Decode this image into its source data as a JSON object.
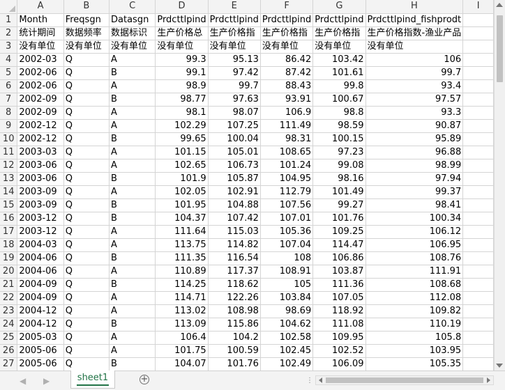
{
  "columns": [
    "A",
    "B",
    "C",
    "D",
    "E",
    "F",
    "G",
    "H",
    "I"
  ],
  "header_rows": [
    [
      "Month",
      "Freqsgn",
      "Datasgn",
      "Prdcttlpind",
      "Prdcttlpind",
      "Prdcttlpind",
      "Prdcttlpind",
      "Prdcttlpind_fishprodt",
      ""
    ],
    [
      "统计期间",
      "数据频率",
      "数据标识",
      "生产价格总",
      "生产价格指",
      "生产价格指",
      "生产价格指",
      "生产价格指数-渔业产品",
      ""
    ],
    [
      "没有单位",
      "没有单位",
      "没有单位",
      "没有单位",
      "没有单位",
      "没有单位",
      "没有单位",
      "没有单位",
      ""
    ]
  ],
  "data_rows": [
    [
      "2002-03",
      "Q",
      "A",
      "99.3",
      "95.13",
      "86.42",
      "103.42",
      "106"
    ],
    [
      "2002-06",
      "Q",
      "B",
      "99.1",
      "97.42",
      "87.42",
      "101.61",
      "99.7"
    ],
    [
      "2002-06",
      "Q",
      "A",
      "98.9",
      "99.7",
      "88.43",
      "99.8",
      "93.4"
    ],
    [
      "2002-09",
      "Q",
      "B",
      "98.77",
      "97.63",
      "93.91",
      "100.67",
      "97.57"
    ],
    [
      "2002-09",
      "Q",
      "A",
      "98.1",
      "98.07",
      "106.9",
      "98.8",
      "93.3"
    ],
    [
      "2002-12",
      "Q",
      "A",
      "102.29",
      "107.25",
      "111.49",
      "98.59",
      "90.87"
    ],
    [
      "2002-12",
      "Q",
      "B",
      "99.65",
      "100.04",
      "98.31",
      "100.15",
      "95.89"
    ],
    [
      "2003-03",
      "Q",
      "A",
      "101.15",
      "105.01",
      "108.65",
      "97.23",
      "96.88"
    ],
    [
      "2003-06",
      "Q",
      "A",
      "102.65",
      "106.73",
      "101.24",
      "99.08",
      "98.99"
    ],
    [
      "2003-06",
      "Q",
      "B",
      "101.9",
      "105.87",
      "104.95",
      "98.16",
      "97.94"
    ],
    [
      "2003-09",
      "Q",
      "A",
      "102.05",
      "102.91",
      "112.79",
      "101.49",
      "99.37"
    ],
    [
      "2003-09",
      "Q",
      "B",
      "101.95",
      "104.88",
      "107.56",
      "99.27",
      "98.41"
    ],
    [
      "2003-12",
      "Q",
      "B",
      "104.37",
      "107.42",
      "107.01",
      "101.76",
      "100.34"
    ],
    [
      "2003-12",
      "Q",
      "A",
      "111.64",
      "115.03",
      "105.36",
      "109.25",
      "106.12"
    ],
    [
      "2004-03",
      "Q",
      "A",
      "113.75",
      "114.82",
      "107.04",
      "114.47",
      "106.95"
    ],
    [
      "2004-06",
      "Q",
      "B",
      "111.35",
      "116.54",
      "108",
      "106.86",
      "108.76"
    ],
    [
      "2004-06",
      "Q",
      "A",
      "110.89",
      "117.37",
      "108.91",
      "103.87",
      "111.91"
    ],
    [
      "2004-09",
      "Q",
      "B",
      "114.25",
      "118.62",
      "105",
      "111.36",
      "108.68"
    ],
    [
      "2004-09",
      "Q",
      "A",
      "114.71",
      "122.26",
      "103.84",
      "107.05",
      "112.08"
    ],
    [
      "2004-12",
      "Q",
      "A",
      "113.02",
      "108.98",
      "98.69",
      "118.92",
      "109.82"
    ],
    [
      "2004-12",
      "Q",
      "B",
      "113.09",
      "115.86",
      "104.62",
      "111.08",
      "110.19"
    ],
    [
      "2005-03",
      "Q",
      "A",
      "106.4",
      "104.2",
      "102.58",
      "109.95",
      "105.8"
    ],
    [
      "2005-06",
      "Q",
      "A",
      "101.75",
      "100.59",
      "102.45",
      "102.52",
      "103.95"
    ],
    [
      "2005-06",
      "Q",
      "B",
      "104.07",
      "101.76",
      "102.49",
      "106.09",
      "105.35"
    ]
  ],
  "sheet_tab": {
    "label": "sheet1",
    "accent": "#217346"
  },
  "add_sheet_symbol": "+",
  "nav": {
    "first": "◀",
    "last": "▶"
  },
  "icons": [
    "first-sheet-icon",
    "last-sheet-icon",
    "add-sheet-icon",
    "scroll-up-icon",
    "scroll-down-icon",
    "scroll-left-icon",
    "scroll-right-icon"
  ]
}
